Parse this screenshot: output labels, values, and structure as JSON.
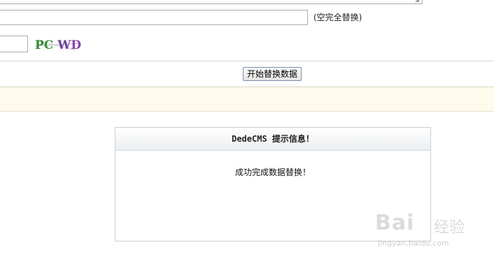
{
  "form": {
    "replace_note": "(空完全替换)",
    "captcha_text": "PC WD",
    "start_button_label": "开始替换数据"
  },
  "message_box": {
    "title": "DedeCMS 提示信息！",
    "body": "成功完成数据替换！"
  },
  "watermark": {
    "brand": "Bai",
    "brand_cn": "经验",
    "url": "jingyan.baidu.com"
  }
}
